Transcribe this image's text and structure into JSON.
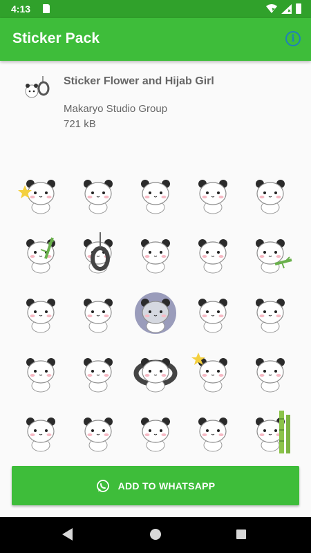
{
  "status_bar": {
    "time": "4:13",
    "icons": [
      "sd-card-icon",
      "wifi-icon",
      "signal-icon",
      "battery-icon"
    ]
  },
  "app_bar": {
    "title": "Sticker Pack",
    "info_icon": "info-icon"
  },
  "pack": {
    "title": "Sticker Flower and Hijab Girl",
    "publisher": "Makaryo Studio Group",
    "size": "721 kB"
  },
  "stickers": [
    "panda-star",
    "panda-sitting",
    "panda-lying",
    "panda-cheeks",
    "panda-back",
    "panda-bamboo-lying",
    "panda-tire-swing",
    "panda-point",
    "panda-startled",
    "panda-bamboo-hold",
    "panda-wave",
    "panda-hug-knees",
    "panda-dark-aura",
    "panda-hands-mouth",
    "panda-standing",
    "panda-crying",
    "panda-shocked",
    "panda-in-tire",
    "panda-spark",
    "panda-shy",
    "panda-blowing",
    "panda-blush",
    "panda-sleeping",
    "panda-peek",
    "panda-bamboo-tree"
  ],
  "actions": {
    "add_to_whatsapp": "ADD TO WHATSAPP"
  },
  "colors": {
    "primary": "#3ebd3a",
    "status_bar": "#30a12b",
    "info": "#1f7fbd",
    "text": "#666666"
  }
}
